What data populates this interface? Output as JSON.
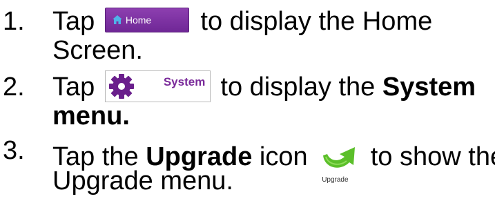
{
  "steps": [
    {
      "number": "1.",
      "before": "Tap ",
      "button_label": "Home",
      "after": " to display the Home",
      "line2": "Screen."
    },
    {
      "number": "2.",
      "before": "Tap ",
      "button_label": "System",
      "after": " to display the ",
      "after_bold": "System",
      "line2_bold": "menu."
    },
    {
      "number": "3.",
      "before": "Tap the ",
      "bold": "Upgrade",
      "middle": " icon ",
      "icon_label": "Upgrade",
      "after": " to show the",
      "line2": "Upgrade menu."
    }
  ],
  "colors": {
    "home_button": "#7a2e9e",
    "home_icon": "#4fb3e8",
    "system_gear": "#6a1f8c",
    "system_label": "#7a2a9a",
    "upgrade_arrow": "#5bbf2a"
  },
  "icons": [
    "home-icon",
    "gear-icon",
    "upgrade-arrow-icon"
  ]
}
